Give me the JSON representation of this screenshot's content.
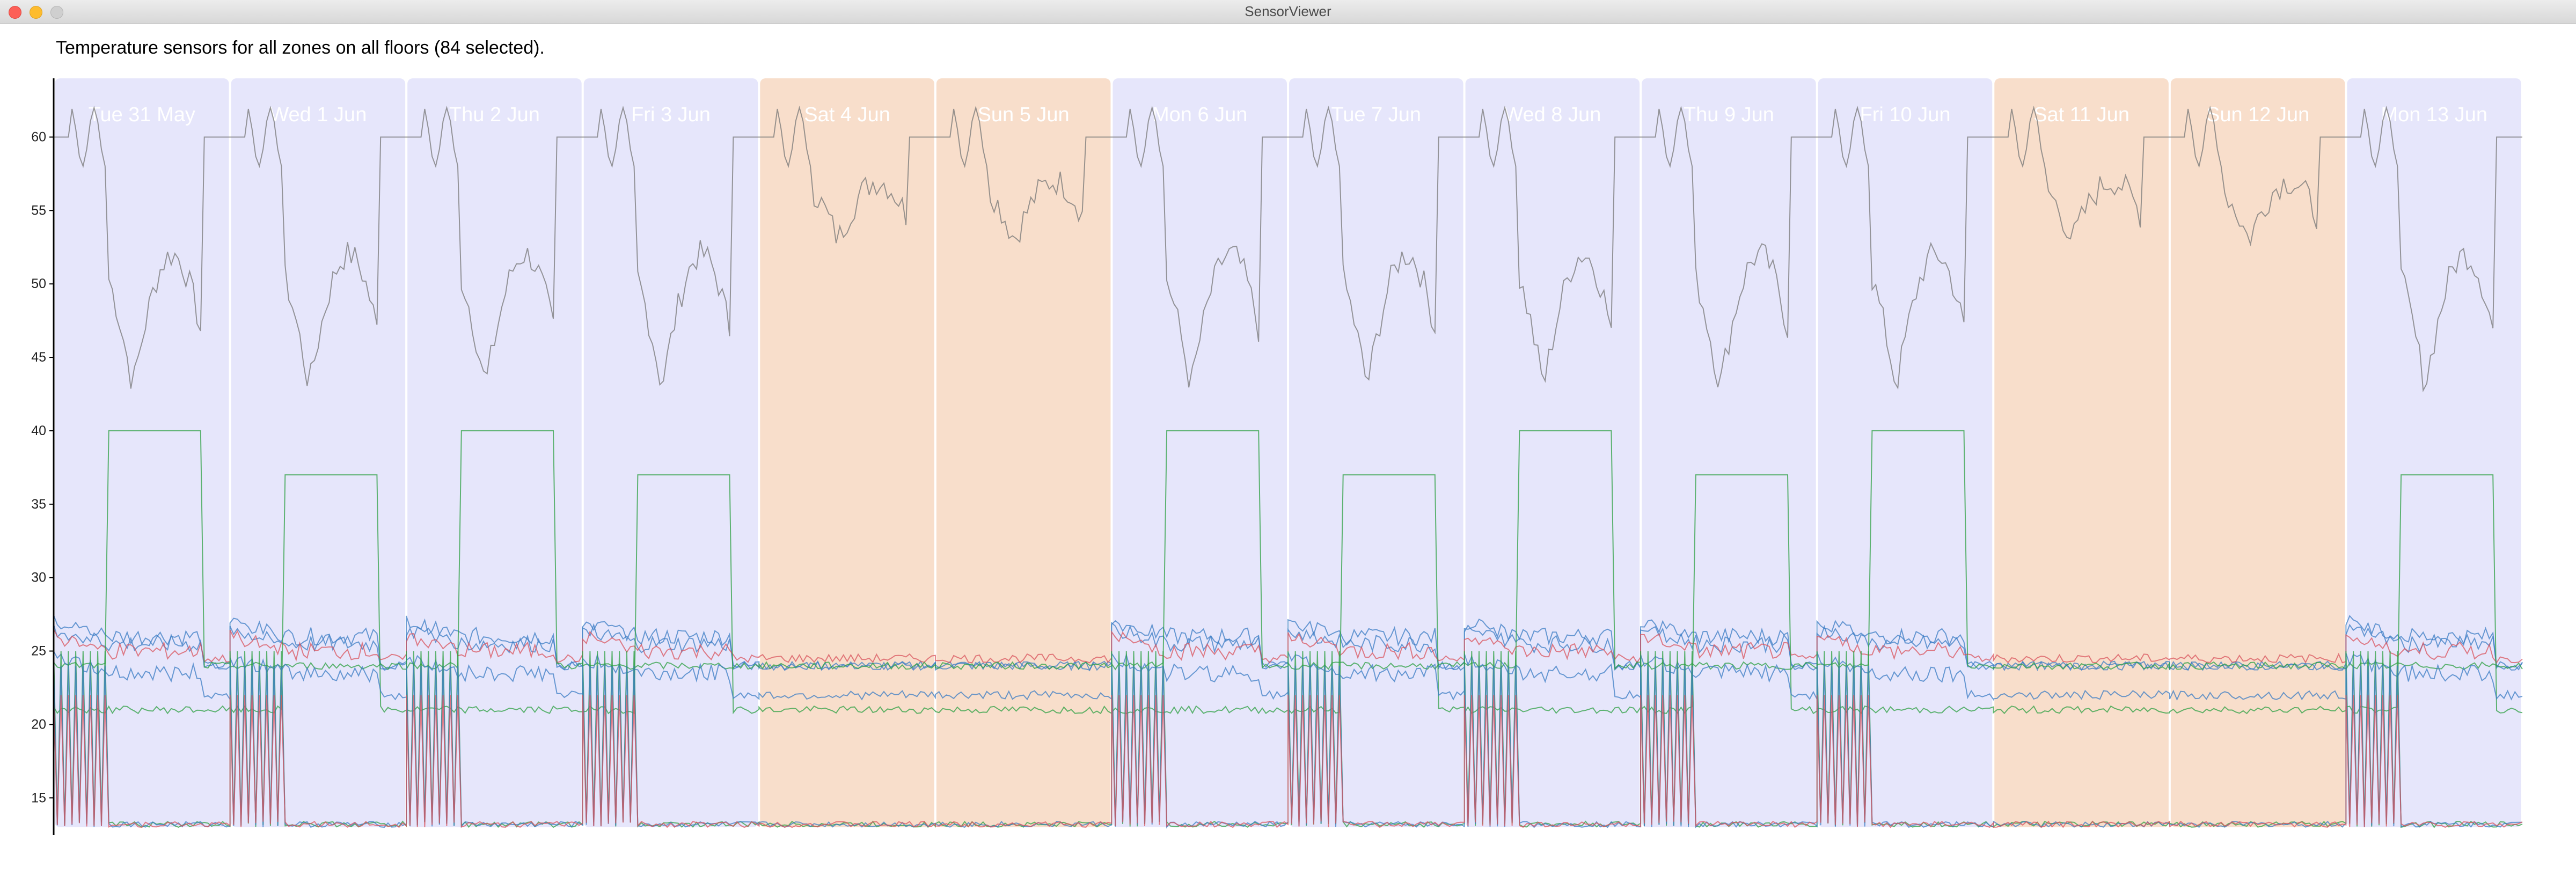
{
  "window": {
    "title": "SensorViewer"
  },
  "caption": "Temperature sensors for all zones on all floors (84 selected).",
  "colors": {
    "weekday_band": "#e6e6fb",
    "weekend_band": "#f8decb",
    "band_separator": "#ffffff",
    "axis": "#000000",
    "series_blue": "#3b7cc4",
    "series_green": "#2ea043",
    "series_red": "#d9545e",
    "series_gray": "#777777"
  },
  "chart_data": {
    "type": "line",
    "title": "",
    "xlabel": "",
    "ylabel": "",
    "ylim": [
      13,
      64
    ],
    "yticks": [
      15,
      20,
      25,
      30,
      35,
      40,
      45,
      50,
      55,
      60
    ],
    "grid": false,
    "legend": "none",
    "series_count": 84,
    "days": [
      {
        "label": "Tue 31 May",
        "weekend": false
      },
      {
        "label": "Wed 1 Jun",
        "weekend": false
      },
      {
        "label": "Thu 2 Jun",
        "weekend": false
      },
      {
        "label": "Fri 3 Jun",
        "weekend": false
      },
      {
        "label": "Sat 4 Jun",
        "weekend": true
      },
      {
        "label": "Sun 5 Jun",
        "weekend": true
      },
      {
        "label": "Mon 6 Jun",
        "weekend": false
      },
      {
        "label": "Tue 7 Jun",
        "weekend": false
      },
      {
        "label": "Wed 8 Jun",
        "weekend": false
      },
      {
        "label": "Thu 9 Jun",
        "weekend": false
      },
      {
        "label": "Fri 10 Jun",
        "weekend": false
      },
      {
        "label": "Sat 11 Jun",
        "weekend": true
      },
      {
        "label": "Sun 12 Jun",
        "weekend": true
      },
      {
        "label": "Mon 13 Jun",
        "weekend": false
      }
    ],
    "series": [
      {
        "color": "gray",
        "baseline": 60,
        "day_pattern": "dip",
        "day_min": 42,
        "weekend_min": 52
      },
      {
        "color": "blue",
        "baseline": 24,
        "day_pattern": "work",
        "day_level": 26
      },
      {
        "color": "blue",
        "baseline": 24,
        "day_pattern": "work",
        "day_level": 25.5
      },
      {
        "color": "red",
        "baseline": 24.5,
        "day_pattern": "work",
        "day_level": 25
      },
      {
        "color": "green",
        "baseline": 24,
        "day_pattern": "step",
        "day_level": 40
      },
      {
        "color": "green",
        "baseline": 21,
        "day_pattern": "step",
        "day_level": 37
      },
      {
        "color": "blue",
        "baseline": 22,
        "day_pattern": "work",
        "day_level": 23.5
      },
      {
        "color": "green",
        "baseline": 13,
        "day_pattern": "spikes",
        "day_level": 25
      },
      {
        "color": "blue",
        "baseline": 13,
        "day_pattern": "spikes",
        "day_level": 24
      },
      {
        "color": "red",
        "baseline": 13,
        "day_pattern": "spikes",
        "day_level": 22
      }
    ]
  }
}
